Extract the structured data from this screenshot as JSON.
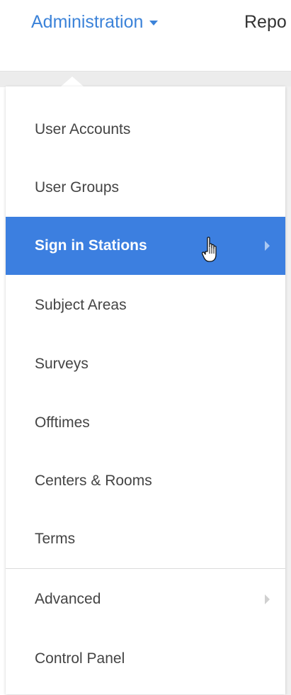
{
  "nav": {
    "administration_label": "Administration",
    "reports_label": "Repo"
  },
  "menu": {
    "items": [
      {
        "label": "User Accounts",
        "active": false,
        "submenu": false
      },
      {
        "label": "User Groups",
        "active": false,
        "submenu": false
      },
      {
        "label": "Sign in Stations",
        "active": true,
        "submenu": true
      },
      {
        "label": "Subject Areas",
        "active": false,
        "submenu": false
      },
      {
        "label": "Surveys",
        "active": false,
        "submenu": false
      },
      {
        "label": "Offtimes",
        "active": false,
        "submenu": false
      },
      {
        "label": "Centers & Rooms",
        "active": false,
        "submenu": false
      },
      {
        "label": "Terms",
        "active": false,
        "submenu": false
      },
      {
        "label": "Advanced",
        "active": false,
        "submenu": true
      },
      {
        "label": "Control Panel",
        "active": false,
        "submenu": false
      }
    ]
  },
  "colors": {
    "accent": "#3c83d9",
    "active_background": "#3c7fe0",
    "text": "#444444"
  },
  "icons": {
    "nav_caret": "caret-down-icon",
    "submenu": "chevron-right-icon",
    "cursor": "hand-pointer-cursor-icon"
  }
}
